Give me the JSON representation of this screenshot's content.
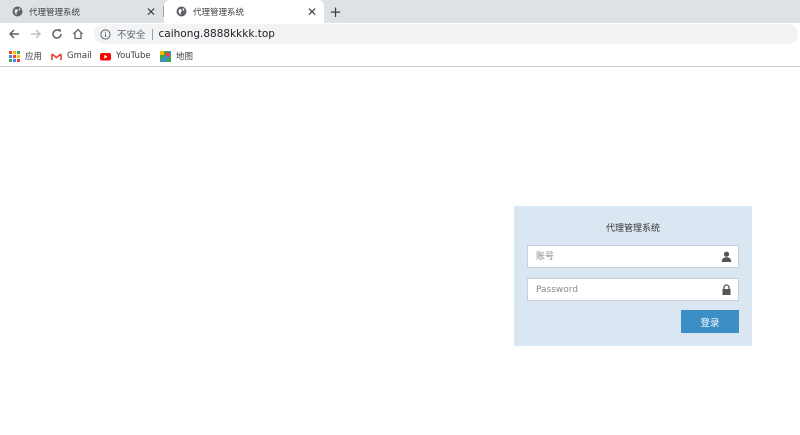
{
  "tabs": [
    {
      "title": "代理管理系统",
      "active": false
    },
    {
      "title": "代理管理系统",
      "active": true
    }
  ],
  "toolbar": {
    "security_label": "不安全",
    "url": "caihong.8888kkkk.top"
  },
  "bookmarks": [
    {
      "label": "应用",
      "icon": "apps-grid-icon"
    },
    {
      "label": "Gmail",
      "icon": "gmail-icon"
    },
    {
      "label": "YouTube",
      "icon": "youtube-icon"
    },
    {
      "label": "地图",
      "icon": "maps-icon"
    }
  ],
  "login": {
    "title": "代理管理系统",
    "username_placeholder": "账号",
    "password_placeholder": "Password",
    "submit_label": "登录"
  },
  "colors": {
    "panel_bg": "#dae7f2",
    "button_bg": "#3b8fc4",
    "tabstrip_bg": "#dee1e6"
  }
}
